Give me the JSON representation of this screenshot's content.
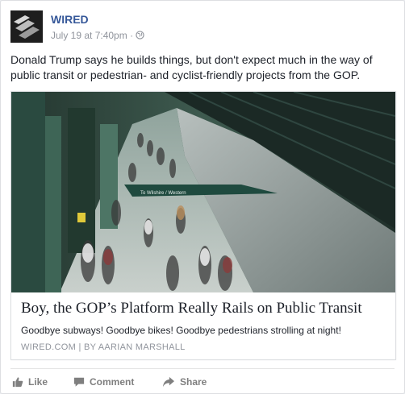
{
  "post": {
    "author": "WIRED",
    "timestamp": "July 19 at 7:40pm",
    "separator": "·",
    "audience_icon": "globe-icon",
    "text": "Donald Trump says he builds things, but don't expect much in the way of public transit or pedestrian- and cyclist-friendly projects from the GOP."
  },
  "link": {
    "image_sign_text": "To Wilshire / Western",
    "title": "Boy, the GOP’s Platform Really Rails on Public Transit",
    "description": "Goodbye subways! Goodbye bikes! Goodbye pedestrians strolling at night!",
    "source": "WIRED.COM  |  BY AARIAN MARSHALL"
  },
  "actions": {
    "like_label": "Like",
    "comment_label": "Comment",
    "share_label": "Share"
  },
  "colors": {
    "author": "#365899",
    "meta": "#90949c",
    "action": "#7f7f7f"
  }
}
